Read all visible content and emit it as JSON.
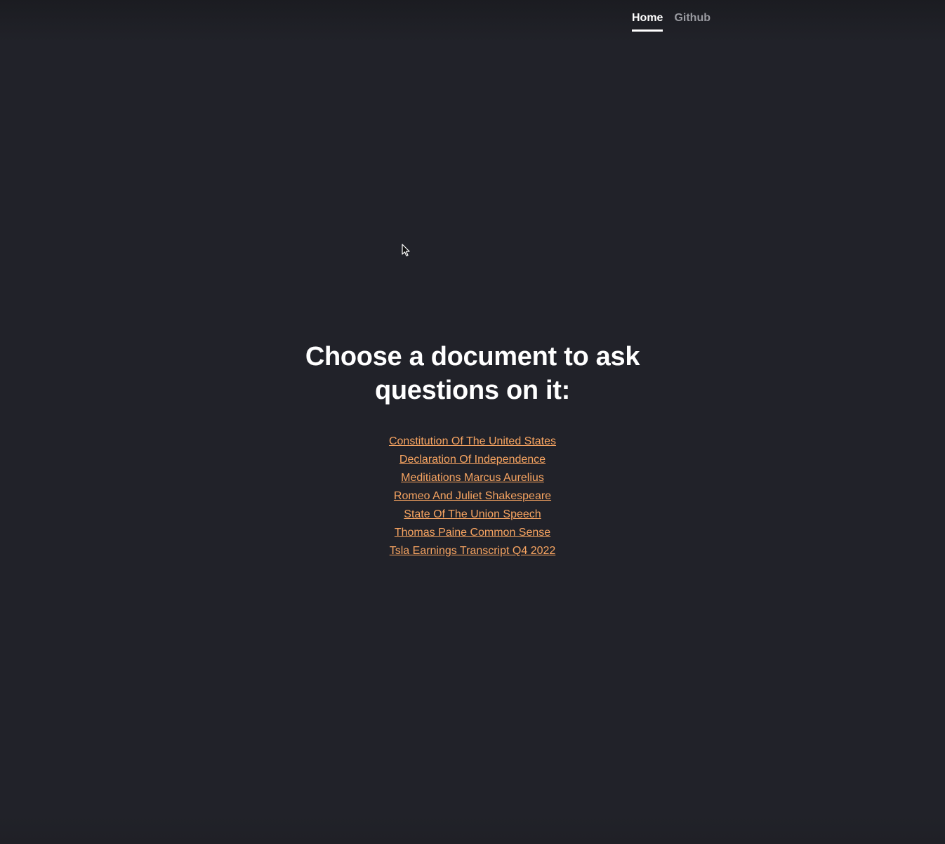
{
  "nav": {
    "items": [
      {
        "label": "Home",
        "active": true
      },
      {
        "label": "Github",
        "active": false
      }
    ]
  },
  "main": {
    "title": "Choose a document to ask questions on it:",
    "documents": [
      "Constitution Of The United States",
      "Declaration Of Independence",
      "Meditiations Marcus Aurelius",
      "Romeo And Juliet Shakespeare",
      "State Of The Union Speech",
      "Thomas Paine Common Sense",
      "Tsla Earnings Transcript Q4 2022"
    ]
  },
  "colors": {
    "background": "#212229",
    "link": "#f7a461",
    "text": "#ffffff",
    "nav_inactive": "#9a9ba1"
  },
  "icons": {
    "cursor": "mouse-pointer-icon"
  }
}
